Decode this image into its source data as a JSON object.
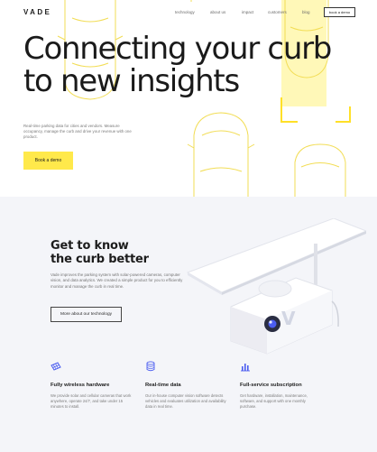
{
  "header": {
    "logo": "VADE",
    "nav": [
      {
        "label": "technology"
      },
      {
        "label": "about us"
      },
      {
        "label": "impact"
      },
      {
        "label": "customers"
      },
      {
        "label": "blog"
      }
    ],
    "cta_label": "book a demo"
  },
  "hero": {
    "title_line1": "Connecting your curb",
    "title_line2": "to new insights",
    "description": "Real-time parking data for cities and vendors. Measure occupancy, manage the curb and drive your revenue with one product.",
    "cta_label": "Book a demo",
    "accent_color": "#ffe94b"
  },
  "product": {
    "title_line1": "Get to know",
    "title_line2": "the curb better",
    "description": "Vade improves the parking system with solar-powered cameras, computer vision, and data analytics. We created a simple product for you to efficiently monitor and manage the curb in real time.",
    "button_label": "More about our technology",
    "features": [
      {
        "icon": "solar-panel-icon",
        "title": "Fully wireless hardware",
        "description": "We provide solar and cellular cameras that work anywhere, operate 24/7, and take under 15 minutes to install."
      },
      {
        "icon": "database-icon",
        "title": "Real-time data",
        "description": "Our in-house computer vision software detects vehicles and evaluates utilization and availability data in real time."
      },
      {
        "icon": "bar-chart-icon",
        "title": "Full-service subscription",
        "description": "Get hardware, installation, maintenance, software, and support with one monthly purchase."
      }
    ]
  }
}
